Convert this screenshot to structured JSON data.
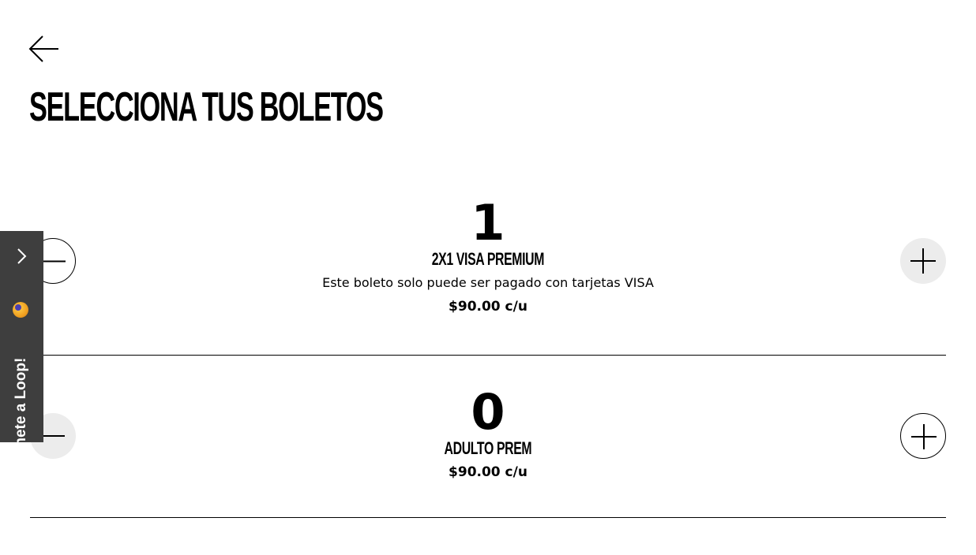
{
  "header": {
    "back_icon": "arrow-left-icon",
    "title": "SELECCIONA TUS BOLETOS"
  },
  "tickets": [
    {
      "quantity": "1",
      "name": "2X1 VISA PREMIUM",
      "description": "Este boleto solo puede ser pagado con tarjetas VISA",
      "price": "$90.00 c/u"
    },
    {
      "quantity": "0",
      "name": "ADULTO PREM",
      "price": "$90.00 c/u"
    }
  ],
  "loop_tab": {
    "label": "Únete a Loop!",
    "chevron_icon": "chevron-right-icon",
    "emoji_icon": "smiley-emoji-icon"
  },
  "colors": {
    "text": "#000000",
    "background": "#ffffff",
    "button_filled": "#ececec",
    "loop_tab": "#3e3e3e"
  }
}
